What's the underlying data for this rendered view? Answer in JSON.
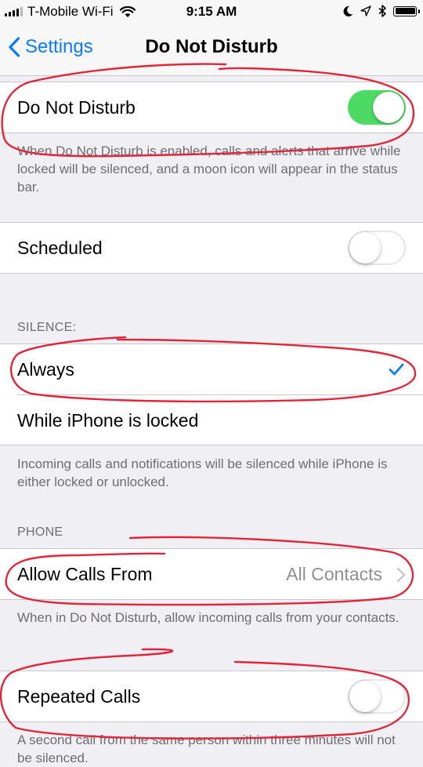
{
  "status_bar": {
    "carrier": "T-Mobile Wi-Fi",
    "time": "9:15 AM",
    "icons": [
      "signal-icon",
      "wifi-icon",
      "moon-icon",
      "location-icon",
      "bluetooth-icon",
      "battery-icon"
    ]
  },
  "nav": {
    "back_label": "Settings",
    "title": "Do Not Disturb"
  },
  "dnd": {
    "label": "Do Not Disturb",
    "enabled": true,
    "footer": "When Do Not Disturb is enabled, calls and alerts that arrive while locked will be silenced, and a moon icon will appear in the status bar."
  },
  "scheduled": {
    "label": "Scheduled",
    "enabled": false
  },
  "silence": {
    "header": "SILENCE:",
    "options": [
      {
        "label": "Always",
        "selected": true
      },
      {
        "label": "While iPhone is locked",
        "selected": false
      }
    ],
    "footer": "Incoming calls and notifications will be silenced while iPhone is either locked or unlocked."
  },
  "phone": {
    "header": "PHONE",
    "allow_calls_label": "Allow Calls From",
    "allow_calls_value": "All Contacts",
    "allow_calls_footer": "When in Do Not Disturb, allow incoming calls from your contacts.",
    "repeated_calls_label": "Repeated Calls",
    "repeated_calls_enabled": false,
    "repeated_calls_footer": "A second call from the same person within three minutes will not be silenced."
  },
  "colors": {
    "ios_blue": "#0a7aff",
    "switch_green": "#4cd964",
    "annotation_red": "#e0263a",
    "group_background": "#efeff4"
  }
}
